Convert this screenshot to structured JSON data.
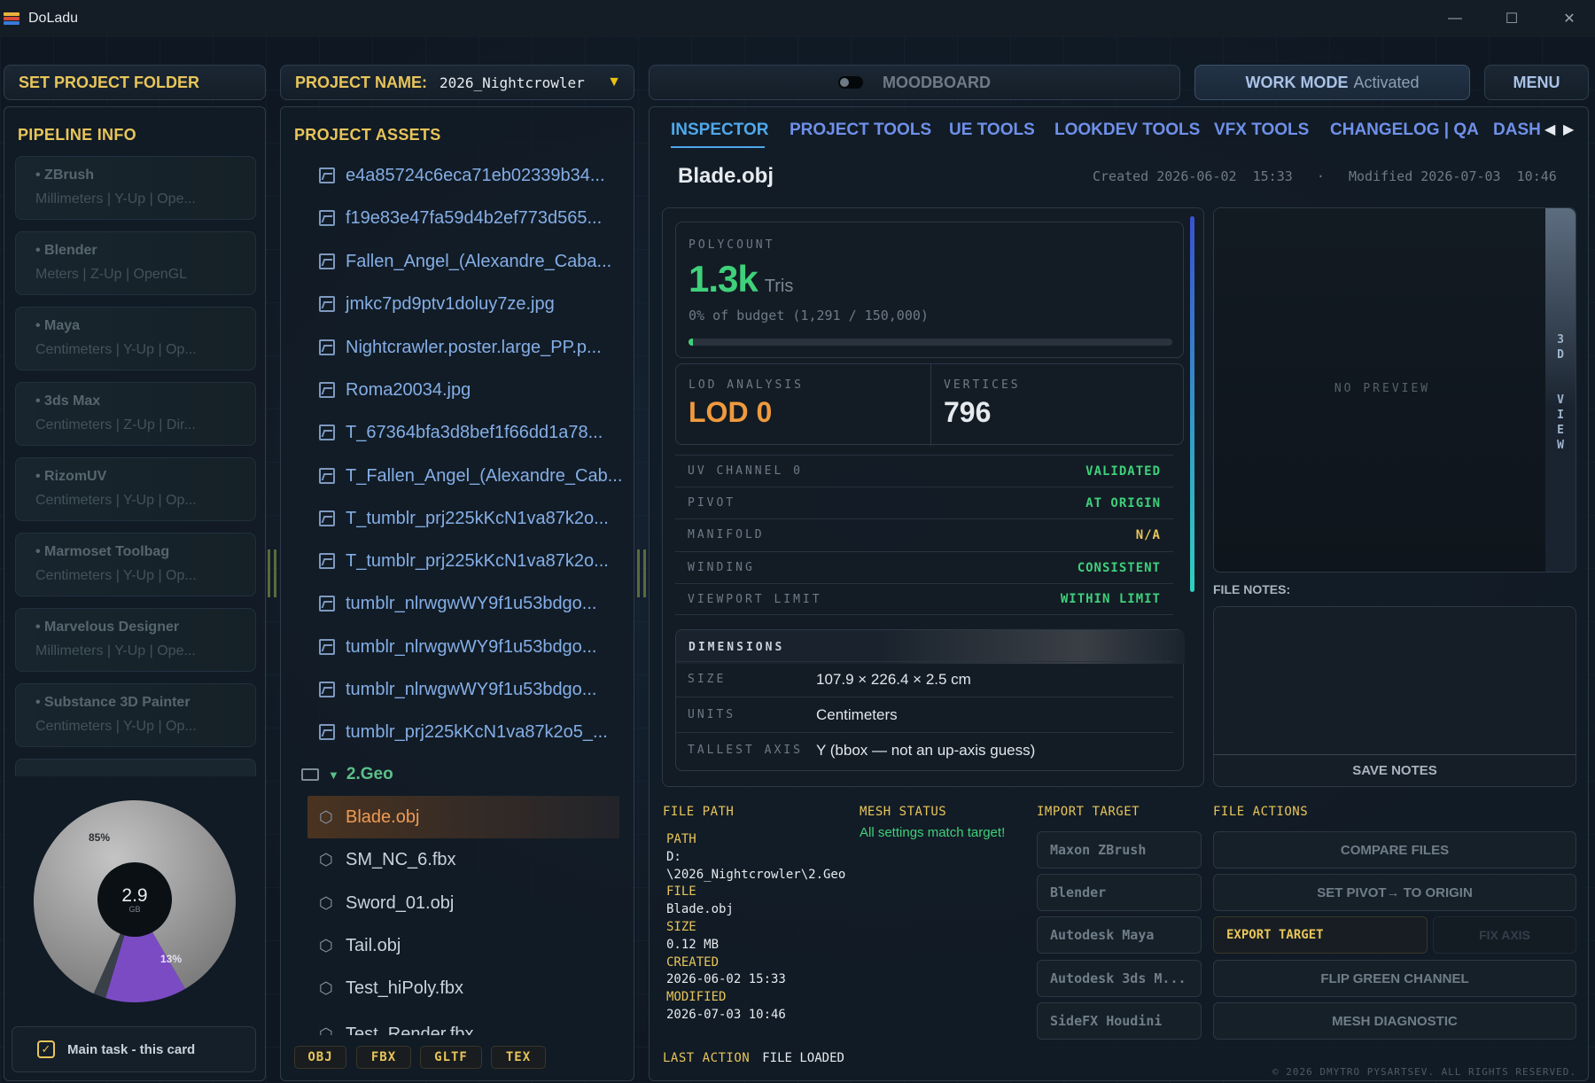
{
  "window": {
    "title": "DoLadu",
    "minimize": "—",
    "maximize": "☐",
    "close": "✕"
  },
  "topbar": {
    "set_folder": "SET PROJECT FOLDER",
    "project_label": "PROJECT NAME:",
    "project_value": "2026_Nightcrowler",
    "moodboard": "MOODBOARD",
    "work_mode": "WORK MODE",
    "work_mode_state": "Activated",
    "menu": "MENU"
  },
  "pipeline": {
    "title": "PIPELINE INFO",
    "items": [
      {
        "name": "• ZBrush",
        "sub": "Millimeters  |  Y-Up  |  Ope..."
      },
      {
        "name": "• Blender",
        "sub": "Meters  |  Z-Up  |  OpenGL"
      },
      {
        "name": "• Maya",
        "sub": "Centimeters  |  Y-Up  |  Op..."
      },
      {
        "name": "• 3ds Max",
        "sub": "Centimeters  |  Z-Up  |  Dir..."
      },
      {
        "name": "• RizomUV",
        "sub": "Centimeters  |  Y-Up  |  Op..."
      },
      {
        "name": "• Marmoset Toolbag",
        "sub": "Centimeters  |  Y-Up  |  Op..."
      },
      {
        "name": "• Marvelous Designer",
        "sub": "Millimeters  |  Y-Up  |  Ope..."
      },
      {
        "name": "• Substance 3D Painter",
        "sub": "Centimeters  |  Y-Up  |  Op..."
      }
    ],
    "disk": {
      "used_label": "85%",
      "other_label": "13%",
      "total": "2.9",
      "unit": "GB"
    },
    "task": "Main task - this card"
  },
  "disk_chart": {
    "chart_data": {
      "type": "pie",
      "categories": [
        "",
        "",
        ""
      ],
      "values": [
        85,
        13,
        2
      ]
    }
  },
  "assets": {
    "title": "PROJECT ASSETS",
    "images": [
      "e4a85724c6eca71eb02339b34...",
      "f19e83e47fa59d4b2ef773d565...",
      "Fallen_Angel_(Alexandre_Caba...",
      "jmkc7pd9ptv1doluy7ze.jpg",
      "Nightcrawler.poster.large_PP.p...",
      "Roma20034.jpg",
      "T_67364bfa3d8bef1f66dd1a78...",
      "T_Fallen_Angel_(Alexandre_Cab...",
      "T_tumblr_prj225kKcN1va87k2o...",
      "T_tumblr_prj225kKcN1va87k2o...",
      "tumblr_nlrwgwWY9f1u53bdgo...",
      "tumblr_nlrwgwWY9f1u53bdgo...",
      "tumblr_nlrwgwWY9f1u53bdgo...",
      "tumblr_prj225kKcN1va87k2o5_..."
    ],
    "folder": "2.Geo",
    "meshes": [
      "Blade.obj",
      "SM_NC_6.fbx",
      "Sword_01.obj",
      "Tail.obj",
      "Test_hiPoly.fbx",
      "Test_Render.fbx"
    ],
    "filters": [
      "OBJ",
      "FBX",
      "GLTF",
      "TEX"
    ]
  },
  "tabs": [
    "INSPECTOR",
    "PROJECT TOOLS",
    "UE TOOLS",
    "LOOKDEV TOOLS",
    "VFX TOOLS",
    "CHANGELOG | QA",
    "DASH"
  ],
  "inspector": {
    "file_title": "Blade.obj",
    "meta": "Created 2026-06-02  15:33   ·   Modified 2026-07-03  10:46",
    "polycount_label": "POLYCOUNT",
    "polycount_value": "1.3k",
    "polycount_unit": "Tris",
    "budget": "0% of budget (1,291 / 150,000)",
    "budget_fraction": 0.0086,
    "lod_label": "LOD ANALYSIS",
    "lod_value": "LOD 0",
    "vertices_label": "VERTICES",
    "vertices_value": "796",
    "checks": [
      {
        "k": "UV CHANNEL 0",
        "v": "VALIDATED",
        "color": "#3fd07a"
      },
      {
        "k": "PIVOT",
        "v": "AT ORIGIN",
        "color": "#3fd07a"
      },
      {
        "k": "MANIFOLD",
        "v": "N/A",
        "color": "#e8c55a"
      },
      {
        "k": "WINDING",
        "v": "CONSISTENT",
        "color": "#3fd07a"
      },
      {
        "k": "VIEWPORT LIMIT",
        "v": "WITHIN LIMIT",
        "color": "#3fd07a"
      }
    ],
    "dimensions_label": "DIMENSIONS",
    "dimensions": [
      {
        "k": "SIZE",
        "v": "107.9 × 226.4 × 2.5 cm"
      },
      {
        "k": "UNITS",
        "v": "Centimeters"
      },
      {
        "k": "TALLEST AXIS",
        "v": "Y (bbox — not an up-axis guess)"
      }
    ],
    "preview": "NO PREVIEW",
    "view3d": "3D VIEW",
    "notes_label": "FILE NOTES:",
    "save_notes": "SAVE NOTES"
  },
  "bottom": {
    "file_path_title": "FILE PATH",
    "path_k": "PATH",
    "path_v1": "D:",
    "path_v2": "\\2026_Nightcrowler\\2.Geo",
    "file_k": "FILE",
    "file_v": "Blade.obj",
    "size_k": "SIZE",
    "size_v": "0.12 MB",
    "created_k": "CREATED",
    "created_v": "2026-06-02 15:33",
    "modified_k": "MODIFIED",
    "modified_v": "2026-07-03 10:46",
    "mesh_status_title": "MESH STATUS",
    "mesh_status": "All settings match target!",
    "import_title": "IMPORT TARGET",
    "imports": [
      "Maxon ZBrush",
      "Blender",
      "Autodesk Maya",
      "Autodesk 3ds M...",
      "SideFX Houdini"
    ],
    "actions_title": "FILE ACTIONS",
    "compare": "COMPARE FILES",
    "set_pivot": "SET PIVOT→ TO ORIGIN",
    "export": "EXPORT TARGET",
    "fix_axis": "FIX AXIS",
    "flip": "FLIP GREEN CHANNEL",
    "diagnostic": "MESH DIAGNOSTIC",
    "last_action_k": "LAST ACTION",
    "last_action_v": "FILE LOADED",
    "copyright": "© 2026 DMYTRO PYSARTSEV. ALL RIGHTS RESERVED."
  }
}
